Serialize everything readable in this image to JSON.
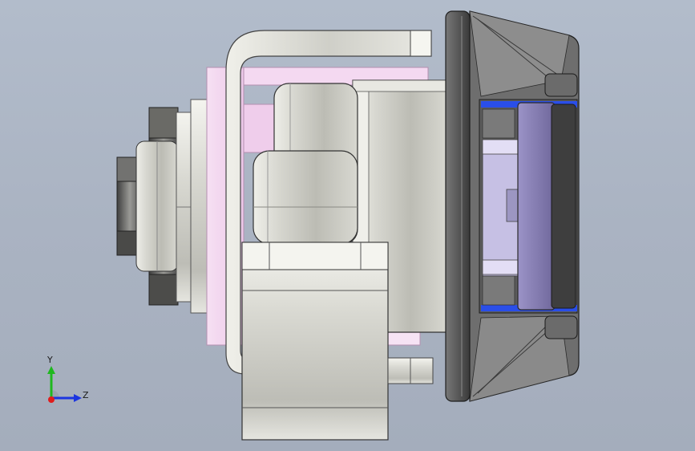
{
  "view": {
    "background_top": "#b2bccb",
    "background_bottom": "#a4adbc"
  },
  "triad": {
    "y_label": "Y",
    "z_label": "Z",
    "y_color": "#1fb81f",
    "z_color": "#1c35e0",
    "x_color": "#e01c1c"
  },
  "part_colors": {
    "metal": "#d2d2cc",
    "dark_metal": "#5d5d5d",
    "pink": "#f3d6f0",
    "lavender": "#8a80b4",
    "blue_accent": "#2a4ee8"
  }
}
